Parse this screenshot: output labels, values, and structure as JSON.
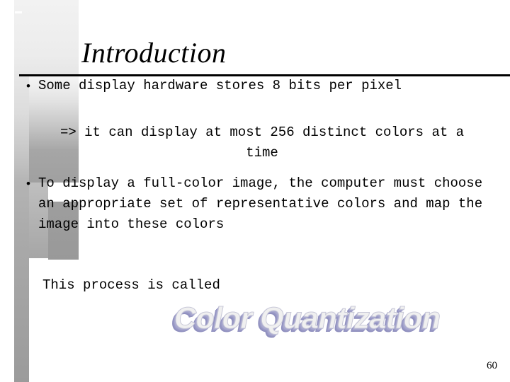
{
  "slide": {
    "title": "Introduction",
    "page_number": "60",
    "bullets": [
      {
        "marker": "•",
        "text": "Some display hardware stores 8 bits per pixel"
      },
      {
        "marker": "•",
        "text": "To display a full-color image, the computer must choose an appropriate set of representative colors and map the image into these colors"
      }
    ],
    "subpoint": "=> it can display at most 256 distinct colors at a time",
    "closing_line": "This process is called",
    "wordart": {
      "text": "Color Quantization",
      "fill_color": "#f0f0f0",
      "shadow_color": "#9d9dc8"
    },
    "decoration": {
      "band_light": "#ececec",
      "band_mid": "#b4b4b4",
      "band_dark": "#999999"
    },
    "rule_color": "#000000"
  }
}
